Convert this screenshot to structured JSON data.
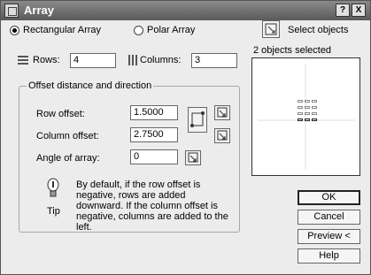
{
  "window": {
    "title": "Array",
    "close_label": "X",
    "help_label": "?"
  },
  "mode": {
    "rectangular_label": "Rectangular Array",
    "polar_label": "Polar Array",
    "selected": "rectangular"
  },
  "selection": {
    "select_objects_label": "Select objects",
    "status": "2 objects selected"
  },
  "rows": {
    "label": "Rows:",
    "value": "4"
  },
  "columns": {
    "label": "Columns:",
    "value": "3"
  },
  "offset_group": {
    "title": "Offset distance and direction",
    "row_offset": {
      "label": "Row offset:",
      "value": "1.5000"
    },
    "column_offset": {
      "label": "Column offset:",
      "value": "2.7500"
    },
    "angle": {
      "label": "Angle of array:",
      "value": "0"
    }
  },
  "tip": {
    "label": "Tip",
    "text": "By default, if the row offset is negative, rows are added downward. If the column offset is negative, columns are added to the left."
  },
  "buttons": {
    "ok": "OK",
    "cancel": "Cancel",
    "preview": "Preview <",
    "help": "Help"
  }
}
